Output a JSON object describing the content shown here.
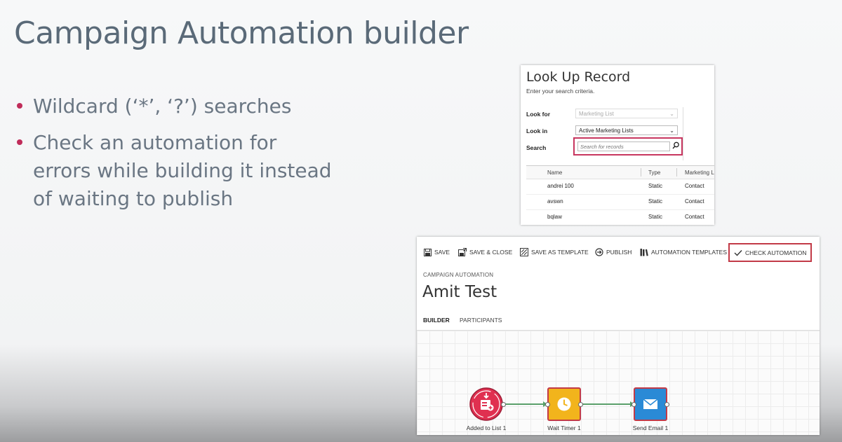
{
  "slide": {
    "title": "Campaign Automation builder",
    "bullets": [
      "Wildcard (‘*’, ‘?’) searches",
      "Check an automation for errors while building it instead of waiting to publish"
    ],
    "bullet_color": "#c02c5a"
  },
  "lookup": {
    "title": "Look Up Record",
    "subtitle": "Enter your search criteria.",
    "look_for_label": "Look for",
    "look_for_value": "Marketing List",
    "look_in_label": "Look in",
    "look_in_value": "Active Marketing Lists",
    "search_label": "Search",
    "search_placeholder": "Search for records",
    "highlight_color": "#c7365f",
    "columns": [
      "Name",
      "Type",
      "Marketing Li"
    ],
    "rows": [
      {
        "name": "andrei 100",
        "type": "Static",
        "member": "Contact"
      },
      {
        "name": "avswn",
        "type": "Static",
        "member": "Contact"
      },
      {
        "name": "bqlaw",
        "type": "Static",
        "member": "Contact"
      }
    ]
  },
  "automation": {
    "toolbar": {
      "save": "SAVE",
      "save_close": "SAVE & CLOSE",
      "save_template": "SAVE AS TEMPLATE",
      "publish": "PUBLISH",
      "templates": "AUTOMATION TEMPLATES",
      "check": "CHECK AUTOMATION"
    },
    "breadcrumb": "CAMPAIGN AUTOMATION",
    "name": "Amit Test",
    "tabs": {
      "builder": "BUILDER",
      "participants": "PARTICIPANTS"
    },
    "nodes": [
      {
        "label": "Added to List 1",
        "icon": "list-add-icon",
        "color": "#e03050"
      },
      {
        "label": "Wait Timer 1",
        "icon": "timer-icon",
        "color": "#f2b41c"
      },
      {
        "label": "Send Email 1",
        "icon": "email-icon",
        "color": "#2a8ad6"
      }
    ],
    "highlight_color": "#c23a47",
    "connector_color": "#5aa06a"
  }
}
